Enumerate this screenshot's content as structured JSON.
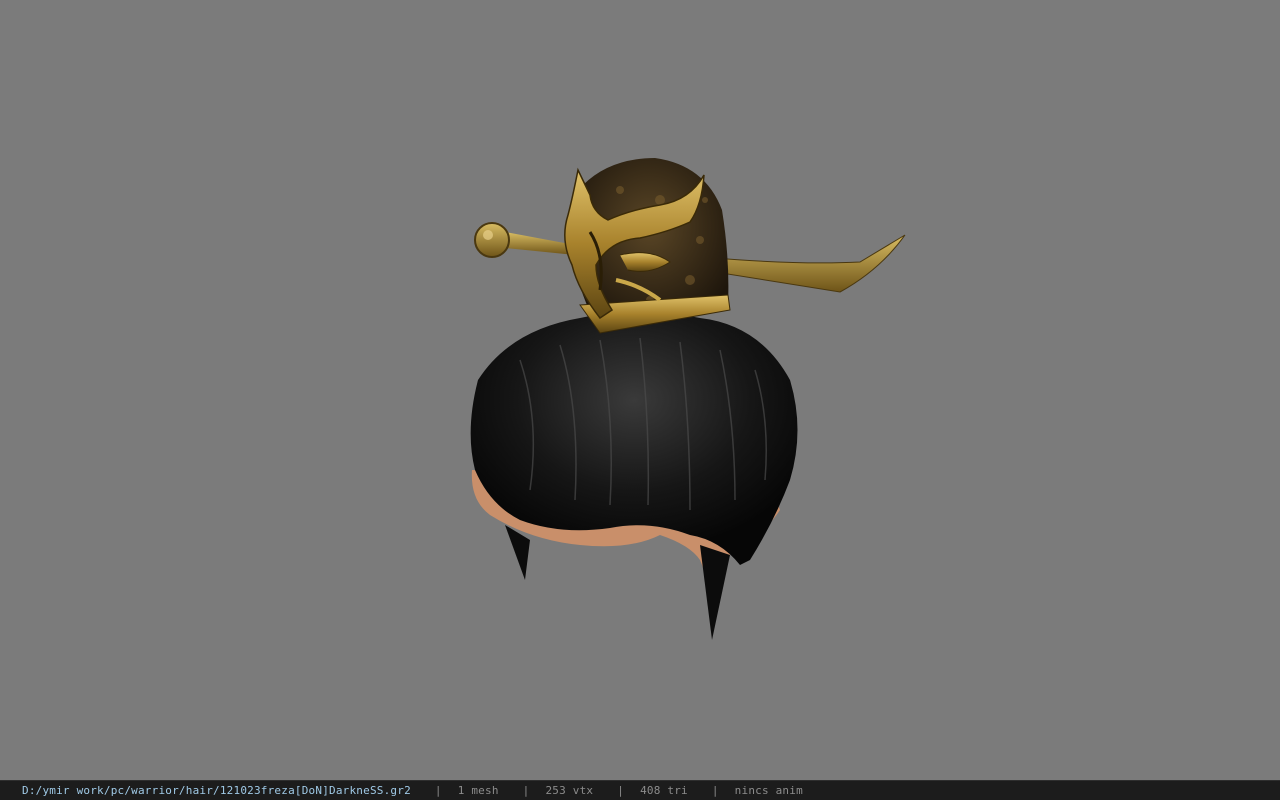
{
  "viewer": {
    "background_color": "#7b7b7b",
    "model_name": "hair-with-ornamental-helmet-model"
  },
  "statusbar": {
    "file_path": "D:/ymir work/pc/warrior/hair/121023freza[DoN]DarkneSS.gr2",
    "separator": "|",
    "mesh_count": "1 mesh",
    "vertex_count": "253 vtx",
    "triangle_count": "408 tri",
    "anim_status": "nincs anim"
  }
}
